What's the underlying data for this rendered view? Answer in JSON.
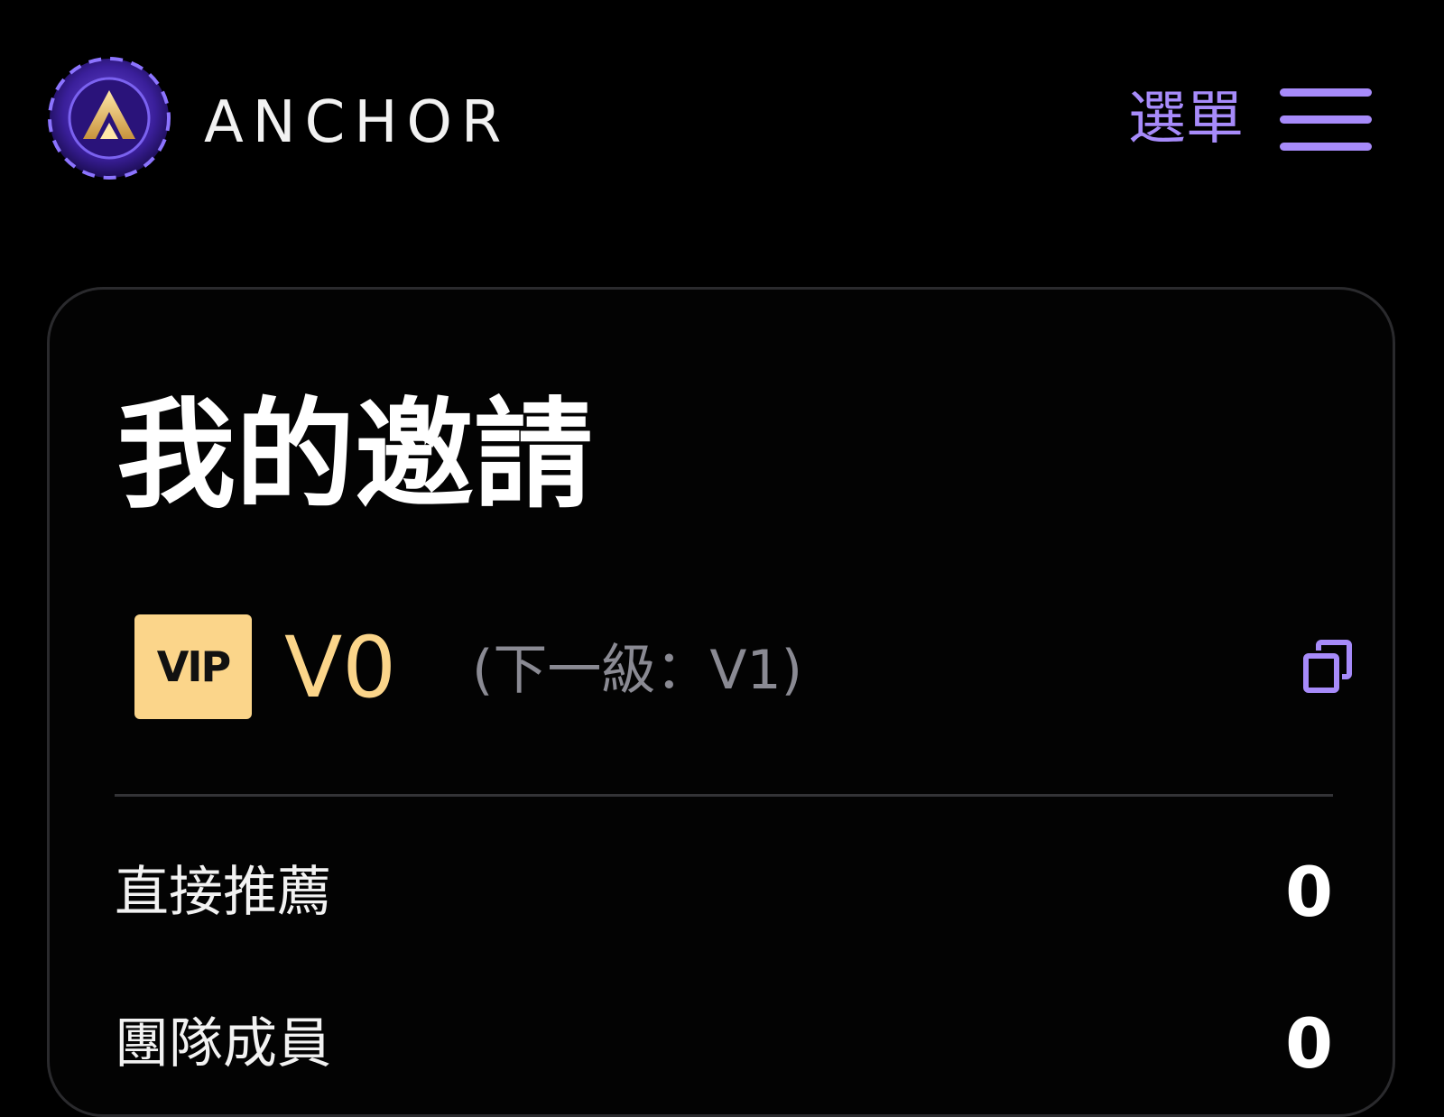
{
  "header": {
    "brand": "ANCHOR",
    "menu_label": "選單"
  },
  "card": {
    "title": "我的邀請",
    "vip": {
      "badge": "VIP",
      "level": "V0",
      "next_level": "(下一級：V1)"
    },
    "stats": [
      {
        "label": "直接推薦",
        "value": "0"
      },
      {
        "label": "團隊成員",
        "value": "0"
      }
    ]
  },
  "icons": {
    "logo": "anchor-logo-icon",
    "menu": "hamburger-icon",
    "copy": "copy-icon"
  },
  "colors": {
    "background": "#000000",
    "accent": "#a78bfa",
    "vip_gold": "#fbd58a",
    "muted": "#8a8a93"
  }
}
